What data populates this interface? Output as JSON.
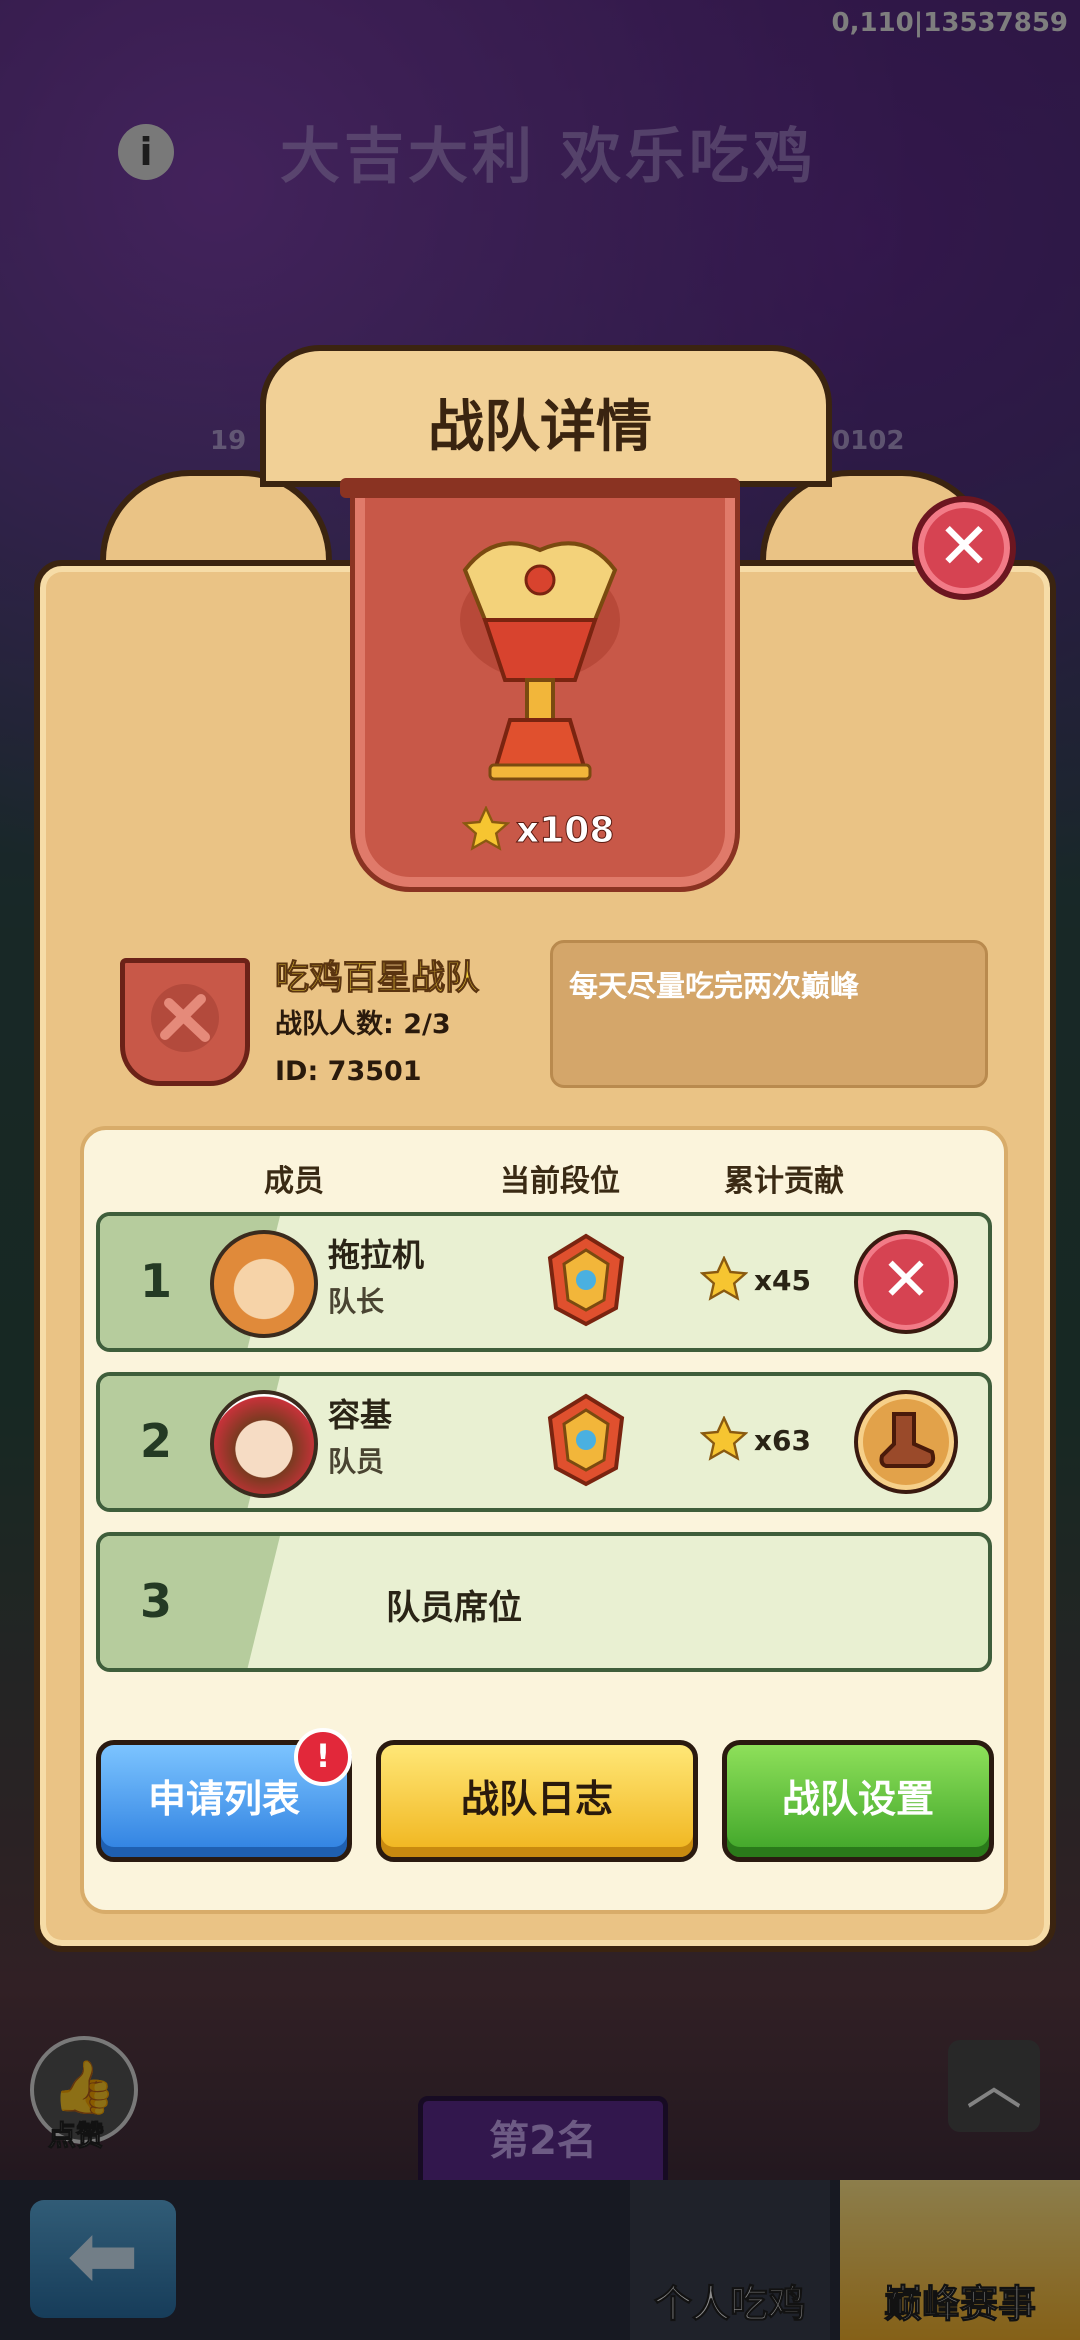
{
  "status": {
    "id_text": "0,110|13537859"
  },
  "background": {
    "event_title": "大吉大利 欢乐吃鸡",
    "left_number": "19",
    "right_number": "20102",
    "rank_plate": "第2名",
    "like_label": "点赞"
  },
  "dialog": {
    "title": "战队详情",
    "trophy_stars": "x108",
    "team_name": "吃鸡百星战队",
    "member_count": "战队人数: 2/3",
    "team_id": "ID: 73501",
    "motto": "每天尽量吃完两次巅峰",
    "close_symbol": "✕"
  },
  "columns": {
    "member": "成员",
    "rank": "当前段位",
    "contribution": "累计贡献"
  },
  "members": [
    {
      "index": "1",
      "name": "拖拉机",
      "role": "队长",
      "contribution": "x45",
      "action_symbol": "✕"
    },
    {
      "index": "2",
      "name": "容基",
      "role": "队员",
      "contribution": "x63"
    }
  ],
  "empty_seat": {
    "index": "3",
    "label": "队员席位"
  },
  "buttons": {
    "apply_list": "申请列表",
    "apply_badge": "!",
    "team_log": "战队日志",
    "team_settings": "战队设置"
  },
  "tabs": {
    "personal": "个人吃鸡",
    "peak": "巅峰赛事"
  },
  "nav": {
    "back_symbol": "⬅",
    "up_symbol": "︿",
    "like_symbol": "👍",
    "info_symbol": "i"
  },
  "colors": {
    "panel": "#eac385",
    "close_red": "#d64352",
    "team_name_yellow": "#f7d43a",
    "row_green": "#e9f0d2"
  }
}
